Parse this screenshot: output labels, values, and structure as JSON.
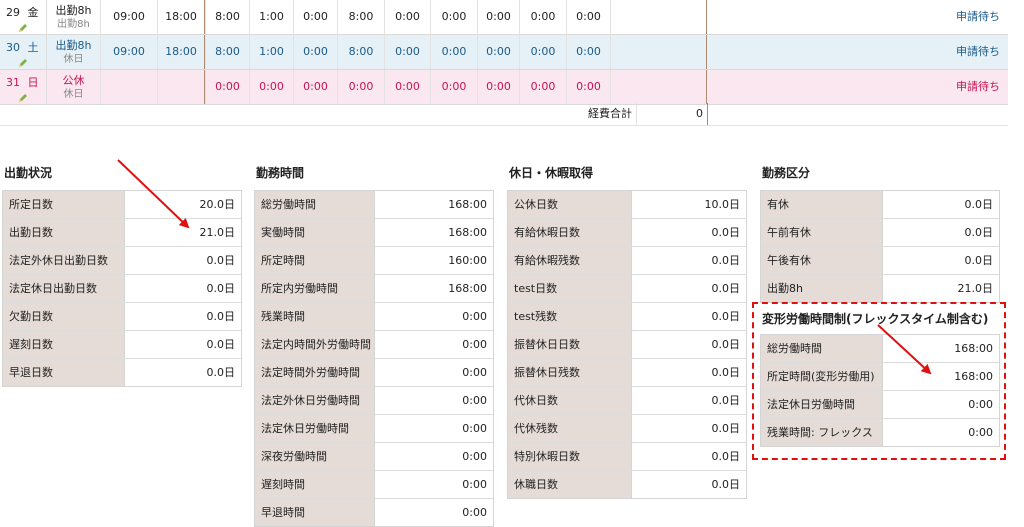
{
  "rows": [
    {
      "date_num": "29",
      "weekday": "金",
      "kind": "出勤8h",
      "sub": "出勤8h",
      "start": "09:00",
      "end": "18:00",
      "t": [
        "8:00",
        "1:00",
        "0:00",
        "8:00",
        "0:00",
        "0:00",
        "0:00",
        "0:00",
        "0:00"
      ],
      "status": "申請待ち"
    },
    {
      "date_num": "30",
      "weekday": "土",
      "kind": "出勤8h",
      "sub": "休日",
      "start": "09:00",
      "end": "18:00",
      "t": [
        "8:00",
        "1:00",
        "0:00",
        "8:00",
        "0:00",
        "0:00",
        "0:00",
        "0:00",
        "0:00"
      ],
      "status": "申請待ち"
    },
    {
      "date_num": "31",
      "weekday": "日",
      "kind": "公休",
      "sub": "休日",
      "start": "",
      "end": "",
      "t": [
        "0:00",
        "0:00",
        "0:00",
        "0:00",
        "0:00",
        "0:00",
        "0:00",
        "0:00",
        "0:00"
      ],
      "status": "申請待ち"
    }
  ],
  "expense": {
    "label": "経費合計",
    "value": "0"
  },
  "attendance": {
    "title": "出勤状況",
    "items": [
      {
        "k": "所定日数",
        "v": "20.0日"
      },
      {
        "k": "出勤日数",
        "v": "21.0日"
      },
      {
        "k": "法定外休日出勤日数",
        "v": "0.0日"
      },
      {
        "k": "法定休日出勤日数",
        "v": "0.0日"
      },
      {
        "k": "欠勤日数",
        "v": "0.0日"
      },
      {
        "k": "遅刻日数",
        "v": "0.0日"
      },
      {
        "k": "早退日数",
        "v": "0.0日"
      }
    ]
  },
  "worktime": {
    "title": "勤務時間",
    "items": [
      {
        "k": "総労働時間",
        "v": "168:00"
      },
      {
        "k": "実働時間",
        "v": "168:00"
      },
      {
        "k": "所定時間",
        "v": "160:00"
      },
      {
        "k": "所定内労働時間",
        "v": "168:00"
      },
      {
        "k": "残業時間",
        "v": "0:00"
      },
      {
        "k": "法定内時間外労働時間",
        "v": "0:00"
      },
      {
        "k": "法定時間外労働時間",
        "v": "0:00"
      },
      {
        "k": "法定外休日労働時間",
        "v": "0:00"
      },
      {
        "k": "法定休日労働時間",
        "v": "0:00"
      },
      {
        "k": "深夜労働時間",
        "v": "0:00"
      },
      {
        "k": "遅刻時間",
        "v": "0:00"
      },
      {
        "k": "早退時間",
        "v": "0:00"
      }
    ]
  },
  "holidays": {
    "title": "休日・休暇取得",
    "items": [
      {
        "k": "公休日数",
        "v": "10.0日"
      },
      {
        "k": "有給休暇日数",
        "v": "0.0日"
      },
      {
        "k": "有給休暇残数",
        "v": "0.0日"
      },
      {
        "k": "test日数",
        "v": "0.0日"
      },
      {
        "k": "test残数",
        "v": "0.0日"
      },
      {
        "k": "振替休日日数",
        "v": "0.0日"
      },
      {
        "k": "振替休日残数",
        "v": "0.0日"
      },
      {
        "k": "代休日数",
        "v": "0.0日"
      },
      {
        "k": "代休残数",
        "v": "0.0日"
      },
      {
        "k": "特別休暇日数",
        "v": "0.0日"
      },
      {
        "k": "休職日数",
        "v": "0.0日"
      }
    ]
  },
  "workclass": {
    "title": "勤務区分",
    "items": [
      {
        "k": "有休",
        "v": "0.0日"
      },
      {
        "k": "午前有休",
        "v": "0.0日"
      },
      {
        "k": "午後有休",
        "v": "0.0日"
      },
      {
        "k": "出勤8h",
        "v": "21.0日"
      }
    ]
  },
  "flex": {
    "title": "変形労働時間制(フレックスタイム制含む)",
    "items": [
      {
        "k": "総労働時間",
        "v": "168:00"
      },
      {
        "k": "所定時間(変形労働用)",
        "v": "168:00"
      },
      {
        "k": "法定休日労働時間",
        "v": "0:00"
      },
      {
        "k": "残業時間: フレックス",
        "v": "0:00"
      }
    ]
  },
  "colors": {
    "accent_blue": "#1a5a8a",
    "holiday_red": "#c8144f",
    "annotation_red": "#e01010",
    "key_bg": "#e6dcd7"
  }
}
